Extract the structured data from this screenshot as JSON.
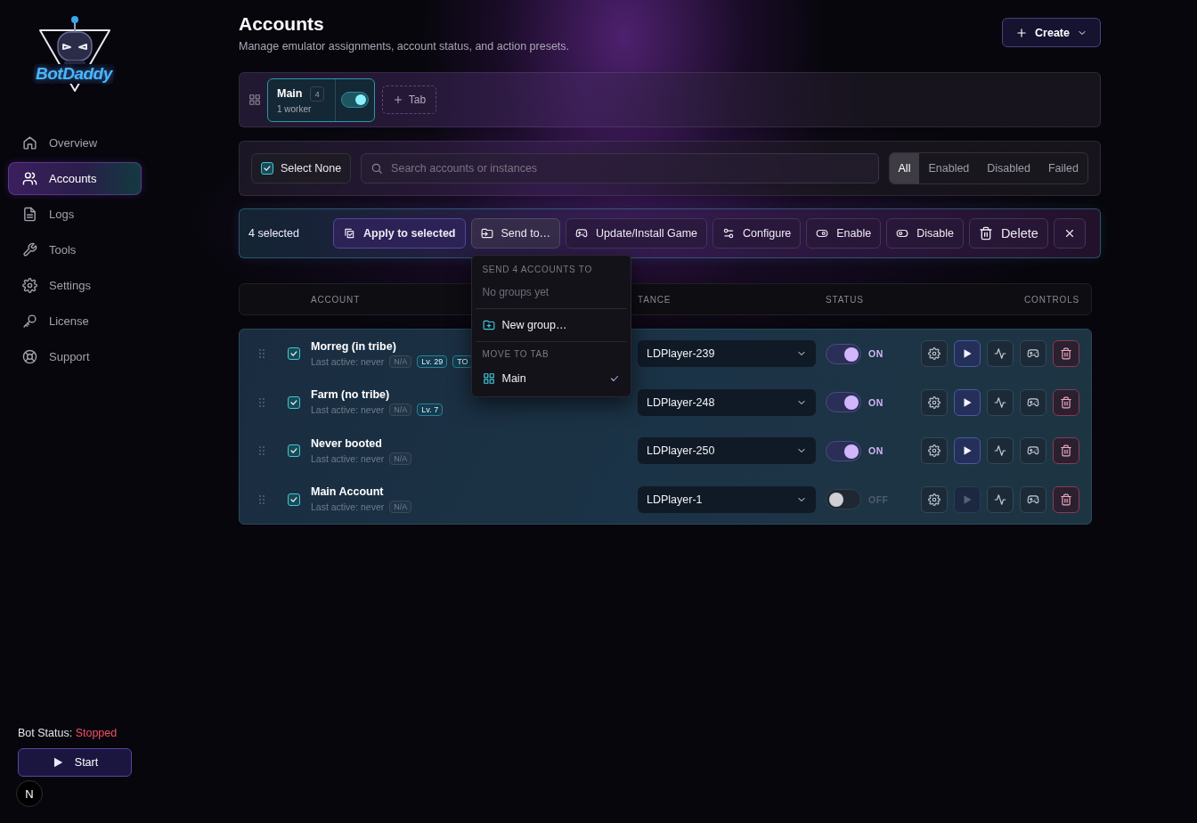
{
  "logo": {
    "text": "BotDaddy"
  },
  "sidebar": {
    "items": [
      {
        "label": "Overview",
        "selected": false
      },
      {
        "label": "Accounts",
        "selected": true
      },
      {
        "label": "Logs",
        "selected": false
      },
      {
        "label": "Tools",
        "selected": false
      },
      {
        "label": "Settings",
        "selected": false
      },
      {
        "label": "License",
        "selected": false
      },
      {
        "label": "Support",
        "selected": false
      }
    ],
    "bot_status": {
      "label": "Bot Status:",
      "value": "Stopped"
    },
    "start_button": "Start",
    "dev_badge": "N"
  },
  "header": {
    "title": "Accounts",
    "subtitle": "Manage emulator assignments, account status, and action presets.",
    "create_button": "Create"
  },
  "tabs": [
    {
      "label": "Main",
      "count": "4",
      "workers": "1 worker",
      "selected": true,
      "on": true
    }
  ],
  "add_tab": "Tab",
  "toolbar": {
    "select_toggle": {
      "label": "Select None",
      "checked": true
    },
    "search": {
      "placeholder": "Search accounts or instances"
    },
    "filters": [
      {
        "label": "All",
        "selected": true
      },
      {
        "label": "Enabled",
        "selected": false
      },
      {
        "label": "Disabled",
        "selected": false
      },
      {
        "label": "Failed",
        "selected": false
      }
    ]
  },
  "bulk_actions": {
    "count": "4 selected",
    "buttons": [
      {
        "label": "Apply to selected",
        "kind": "primary"
      },
      {
        "label": "Send to…",
        "kind": "menu"
      },
      {
        "label": "Update/Install Game",
        "kind": "normal"
      },
      {
        "label": "Configure",
        "kind": "normal"
      },
      {
        "label": "Enable",
        "kind": "normal"
      },
      {
        "label": "Disable",
        "kind": "normal"
      },
      {
        "label": "Delete",
        "kind": "large"
      }
    ]
  },
  "send_menu": {
    "heading": "SEND 4 ACCOUNTS TO",
    "empty": "No groups yet",
    "new_group": "New group…",
    "tab_heading": "MOVE TO TAB",
    "tabs": [
      {
        "label": "Main",
        "selected": true
      }
    ]
  },
  "table": {
    "columns": [
      "ACCOUNT",
      "TANCE",
      "STATUS",
      "CONTROLS"
    ],
    "rows": [
      {
        "checked": true,
        "name": "Morreg (in tribe)",
        "last_active": "Last active: never",
        "tags": [
          {
            "text": "N/A",
            "kind": "muted"
          },
          {
            "text": "Lv. 29",
            "kind": "accent"
          },
          {
            "text": "TO",
            "kind": "accent"
          }
        ],
        "instance": "LDPlayer-239",
        "enabled": true,
        "status": "ON"
      },
      {
        "checked": true,
        "name": "Farm (no tribe)",
        "last_active": "Last active: never",
        "tags": [
          {
            "text": "N/A",
            "kind": "muted"
          },
          {
            "text": "Lv. 7",
            "kind": "accent"
          }
        ],
        "instance": "LDPlayer-248",
        "enabled": true,
        "status": "ON"
      },
      {
        "checked": true,
        "name": "Never booted",
        "last_active": "Last active: never",
        "tags": [
          {
            "text": "N/A",
            "kind": "muted"
          }
        ],
        "instance": "LDPlayer-250",
        "enabled": true,
        "status": "ON"
      },
      {
        "checked": true,
        "name": "Main Account",
        "last_active": "Last active: never",
        "tags": [
          {
            "text": "N/A",
            "kind": "muted"
          }
        ],
        "instance": "LDPlayer-1",
        "enabled": false,
        "status": "OFF"
      }
    ]
  }
}
